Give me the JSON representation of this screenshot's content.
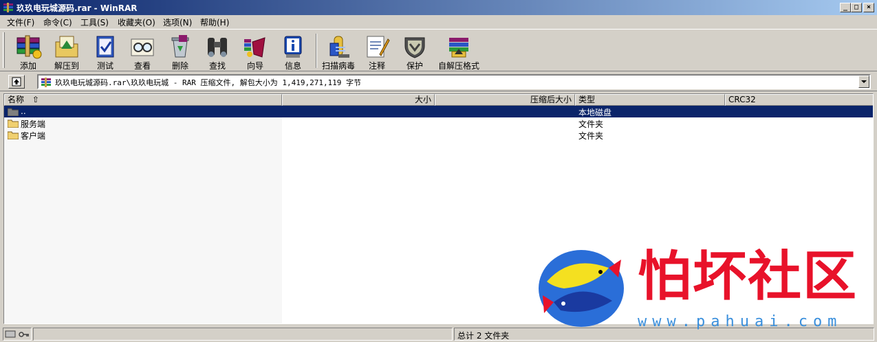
{
  "window": {
    "title": "玖玖电玩城源码.rar - WinRAR",
    "minimize_glyph": "_",
    "maximize_glyph": "□",
    "close_glyph": "×"
  },
  "menu": [
    {
      "label": "文件(F)"
    },
    {
      "label": "命令(C)"
    },
    {
      "label": "工具(S)"
    },
    {
      "label": "收藏夹(O)"
    },
    {
      "label": "选项(N)"
    },
    {
      "label": "帮助(H)"
    }
  ],
  "toolbar": [
    {
      "label": "添加",
      "icon": "books-add-icon"
    },
    {
      "label": "解压到",
      "icon": "extract-folder-icon"
    },
    {
      "label": "测试",
      "icon": "test-book-icon"
    },
    {
      "label": "查看",
      "icon": "view-glasses-icon"
    },
    {
      "label": "删除",
      "icon": "delete-recycle-icon"
    },
    {
      "label": "查找",
      "icon": "find-binoculars-icon"
    },
    {
      "label": "向导",
      "icon": "wizard-icon"
    },
    {
      "label": "信息",
      "icon": "info-icon"
    },
    {
      "label": "扫描病毒",
      "icon": "virus-scan-icon"
    },
    {
      "label": "注释",
      "icon": "comment-icon"
    },
    {
      "label": "保护",
      "icon": "protect-shield-icon"
    },
    {
      "label": "自解压格式",
      "icon": "sfx-icon"
    }
  ],
  "address": {
    "text": "玖玖电玩城源码.rar\\玖玖电玩城 - RAR 压缩文件, 解包大小为 1,419,271,119 字节"
  },
  "columns": [
    {
      "label": "名称"
    },
    {
      "label": "大小"
    },
    {
      "label": "压缩后大小"
    },
    {
      "label": "类型"
    },
    {
      "label": "CRC32"
    }
  ],
  "rows": [
    {
      "name": "..",
      "size": "",
      "packed": "",
      "type": "本地磁盘",
      "crc": "",
      "selected": true
    },
    {
      "name": "服务端",
      "size": "",
      "packed": "",
      "type": "文件夹",
      "crc": "",
      "selected": false
    },
    {
      "name": "客户端",
      "size": "",
      "packed": "",
      "type": "文件夹",
      "crc": "",
      "selected": false
    }
  ],
  "status": {
    "summary": "总计 2 文件夹"
  },
  "watermark": {
    "title": "怕坏社区",
    "url": "www.pahuai.com"
  },
  "colors": {
    "titlebar_start": "#0a246a",
    "titlebar_end": "#a6caf0",
    "selection": "#0a246a",
    "watermark_red": "#e8122a",
    "watermark_blue": "#3a8fdc"
  }
}
